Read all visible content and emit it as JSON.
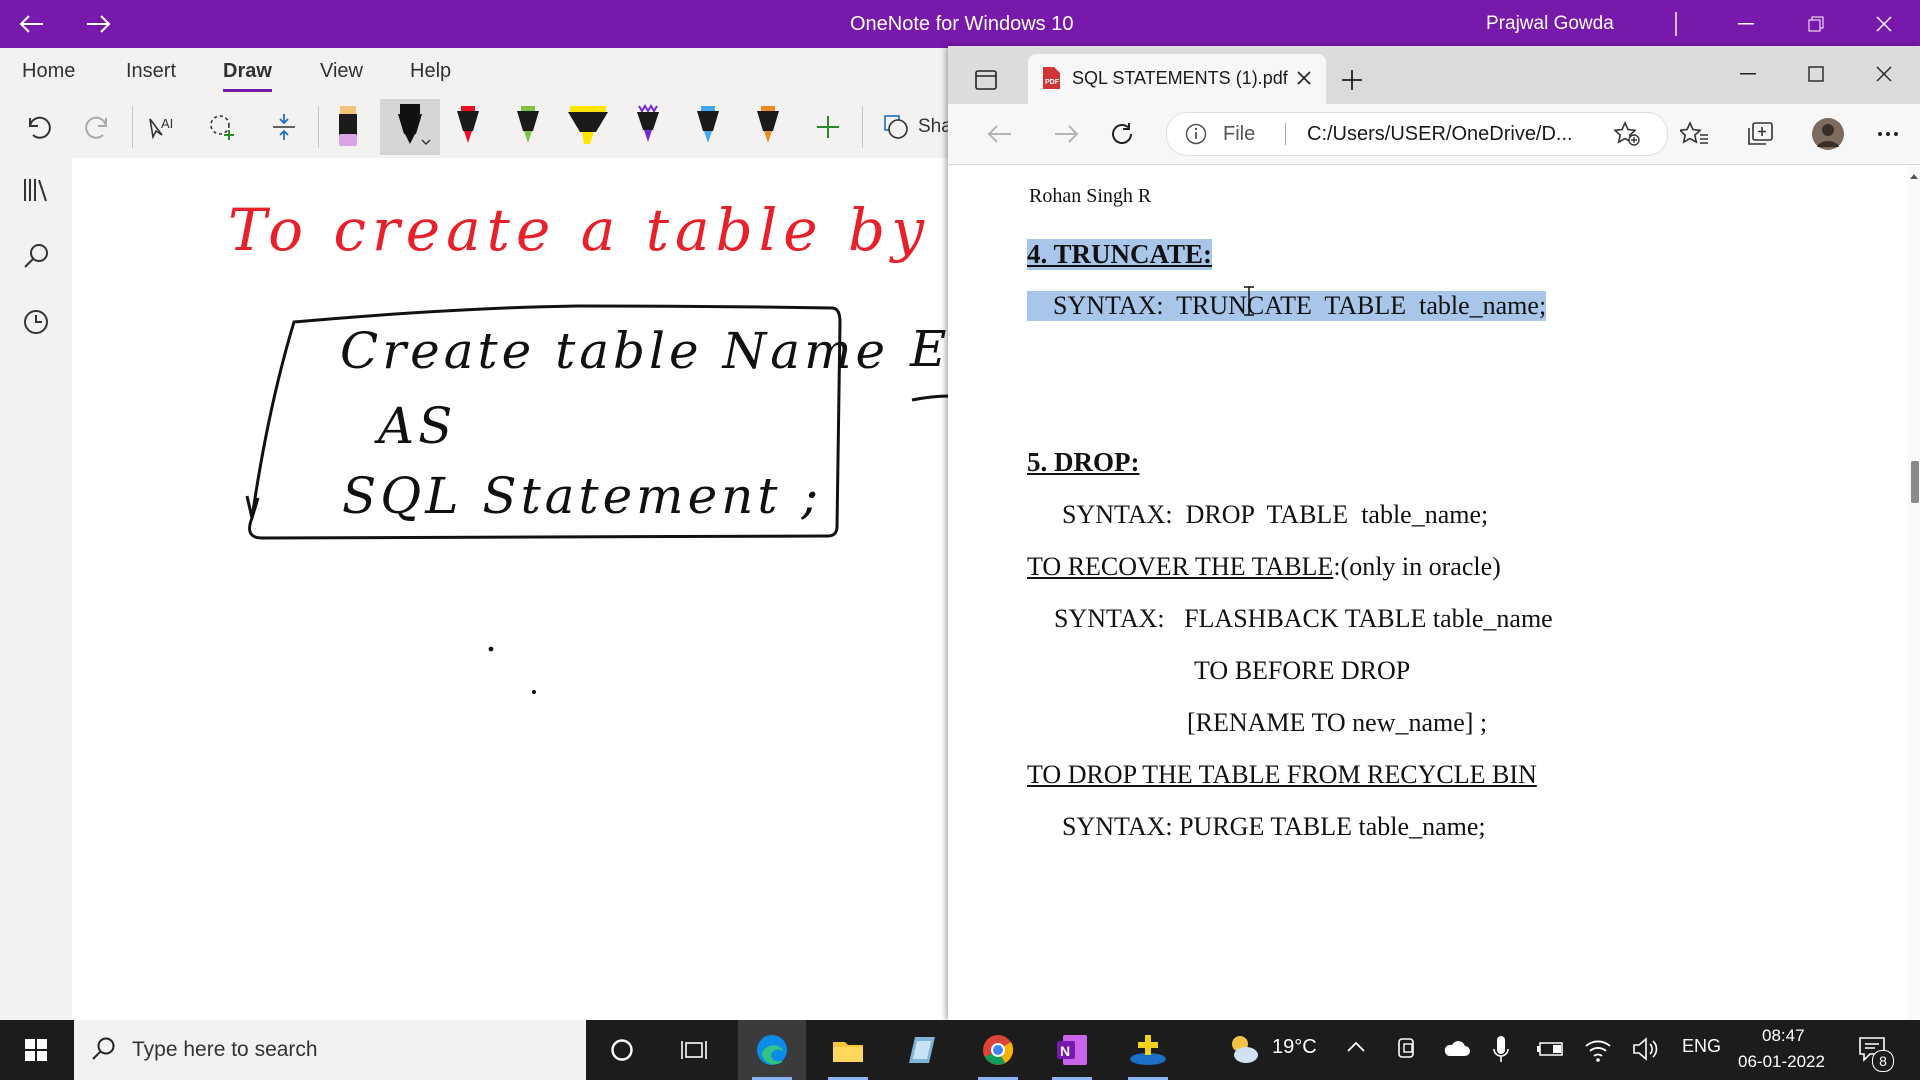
{
  "onenote": {
    "title": "OneNote for Windows 10",
    "user": "Prajwal Gowda",
    "ribbon_tabs": [
      "Home",
      "Insert",
      "Draw",
      "View",
      "Help"
    ],
    "active_tab": "Draw",
    "share_label": "Sha",
    "ink": {
      "heading": "To create a table by exist",
      "box_line1": "Create table Name",
      "box_line2": "AS",
      "box_line3": "SQL Statement ;",
      "side_fragment": "E:"
    },
    "pen_colors": [
      "#e040fb",
      "#111111",
      "#e81123",
      "#7cc242",
      "#ffe600",
      "#7a2bcc",
      "#3fa9f5",
      "#f08a24"
    ]
  },
  "edge": {
    "tab_title": "SQL STATEMENTS (1).pdf",
    "address_prefix": "File",
    "address_url": "C:/Users/USER/OneDrive/D...",
    "pdf": {
      "author": "Rohan Singh R",
      "h4": "4. TRUNCATE:",
      "truncate_syntax": "    SYNTAX:  TRUNCATE  TABLE  table_name;",
      "h5": "5. DROP:",
      "drop_syntax": "SYNTAX:  DROP  TABLE  table_name;",
      "recover_label": "TO RECOVER THE TABLE",
      "recover_note": ":(only in oracle)",
      "flashback_syntax": "SYNTAX:   FLASHBACK TABLE table_name",
      "flashback_line2": "TO BEFORE DROP",
      "flashback_line3": "[RENAME TO new_name] ;",
      "purge_label": "TO DROP THE TABLE FROM RECYCLE BIN",
      "purge_syntax": "SYNTAX: PURGE TABLE table_name;"
    }
  },
  "taskbar": {
    "search_placeholder": "Type here to search",
    "temperature": "19°C",
    "language": "ENG",
    "time": "08:47",
    "date": "06-01-2022",
    "notification_count": "8"
  }
}
